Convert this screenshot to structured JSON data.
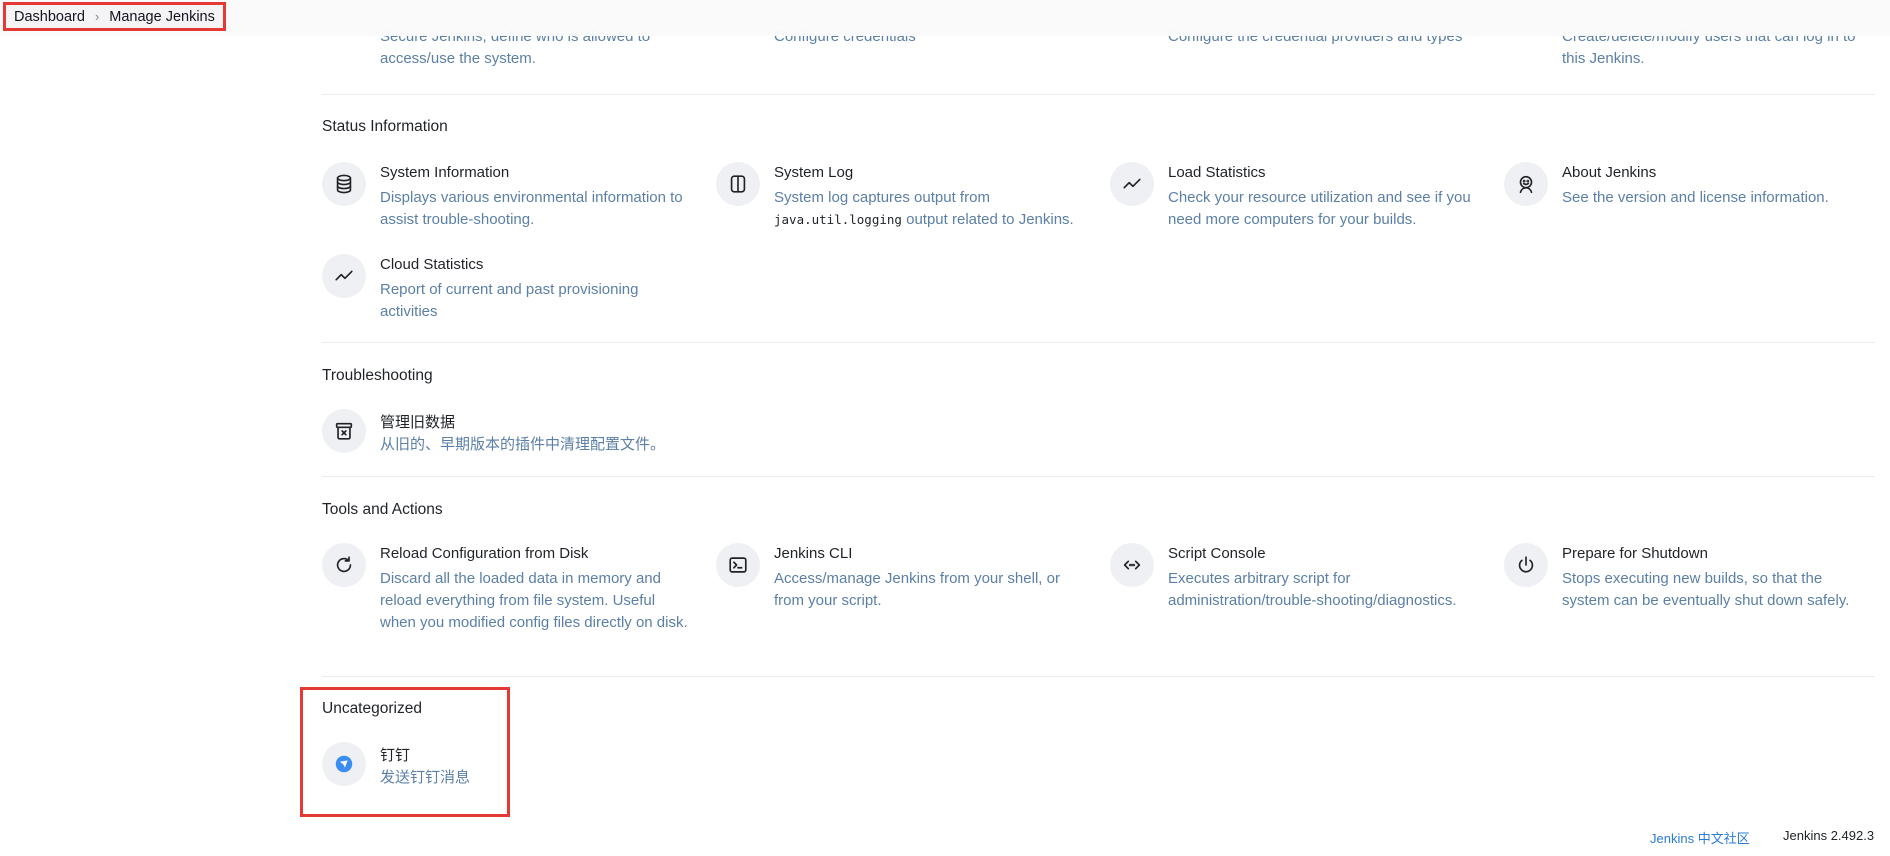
{
  "breadcrumb": {
    "dashboard": "Dashboard",
    "separator": "›",
    "current": "Manage Jenkins"
  },
  "security_partial": [
    {
      "icon": "lock-icon",
      "desc": "Secure Jenkins; define who is allowed to access/use the system."
    },
    {
      "icon": "key-icon",
      "desc": "Configure credentials"
    },
    {
      "icon": "key-gear-icon",
      "desc": "Configure the credential providers and types"
    },
    {
      "icon": "users-icon",
      "desc": "Create/delete/modify users that can log in to this Jenkins."
    }
  ],
  "status": {
    "title": "Status Information",
    "items": [
      {
        "title": "System Information",
        "desc": "Displays various environmental information to assist trouble-shooting."
      },
      {
        "title": "System Log",
        "desc_before": "System log captures output from",
        "desc_code": "java.util.logging",
        "desc_after": "output related to Jenkins."
      },
      {
        "title": "Load Statistics",
        "desc": "Check your resource utilization and see if you need more computers for your builds."
      },
      {
        "title": "About Jenkins",
        "desc": "See the version and license information."
      },
      {
        "title": "Cloud Statistics",
        "desc": "Report of current and past provisioning activities"
      }
    ]
  },
  "troubleshooting": {
    "title": "Troubleshooting",
    "items": [
      {
        "title": "管理旧数据",
        "desc": "从旧的、早期版本的插件中清理配置文件。"
      }
    ]
  },
  "tools": {
    "title": "Tools and Actions",
    "items": [
      {
        "title": "Reload Configuration from Disk",
        "desc": "Discard all the loaded data in memory and reload everything from file system. Useful when you modified config files directly on disk."
      },
      {
        "title": "Jenkins CLI",
        "desc": "Access/manage Jenkins from your shell, or from your script."
      },
      {
        "title": "Script Console",
        "desc": "Executes arbitrary script for administration/trouble-shooting/diagnostics."
      },
      {
        "title": "Prepare for Shutdown",
        "desc": "Stops executing new builds, so that the system can be eventually shut down safely."
      }
    ]
  },
  "uncategorized": {
    "title": "Uncategorized",
    "items": [
      {
        "title": "钉钉",
        "desc": "发送钉钉消息"
      }
    ]
  },
  "footer": {
    "community_link": "Jenkins 中文社区",
    "version": "Jenkins 2.492.3"
  },
  "colors": {
    "accent_link": "#2a7bd6",
    "description": "#5b7fa6",
    "highlight_border": "#e53935",
    "dingtalk_blue": "#3b8ef0"
  }
}
